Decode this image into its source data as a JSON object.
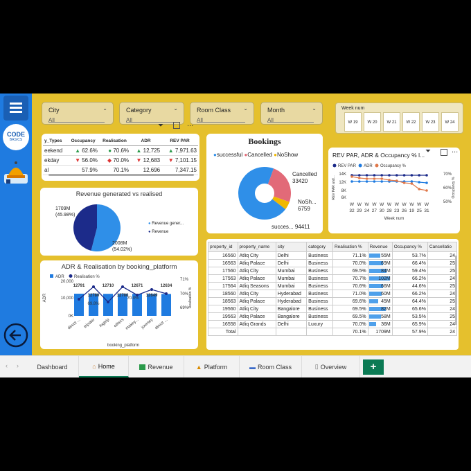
{
  "slicers": [
    {
      "label": "City",
      "value": "All"
    },
    {
      "label": "Category",
      "value": "All"
    },
    {
      "label": "Room Class",
      "value": "All"
    },
    {
      "label": "Month",
      "value": "All"
    }
  ],
  "week_slicer": {
    "label": "Week num",
    "weeks": [
      "W 19",
      "W 20",
      "W 21",
      "W 22",
      "W 23",
      "W 24"
    ]
  },
  "kpi_table": {
    "headers": [
      "y_Types",
      "Occupancy",
      "Realisation",
      "ADR",
      "REV PAR"
    ],
    "rows": [
      {
        "type": "eekend",
        "occupancy": "62.6%",
        "realisation": "70.6%",
        "adr": "12,725",
        "revpar": "7,971.63",
        "occ_icon": "up",
        "real_icon": "circle",
        "adr_icon": "up",
        "rev_icon": "up"
      },
      {
        "type": "ekday",
        "occupancy": "56.0%",
        "realisation": "70.0%",
        "adr": "12,683",
        "revpar": "7,101.15",
        "occ_icon": "down",
        "real_icon": "diamond",
        "adr_icon": "down",
        "rev_icon": "down"
      },
      {
        "type": "al",
        "occupancy": "57.9%",
        "realisation": "70.1%",
        "adr": "12,696",
        "revpar": "7,347.15"
      }
    ]
  },
  "bookings": {
    "title": "Bookings",
    "legend": [
      "successful",
      "Cancelled",
      "NoShow"
    ],
    "labels": {
      "cancelled_name": "Cancelled",
      "cancelled_value": "33420",
      "noshow_name": "NoSh...",
      "noshow_value": "6759",
      "success_name": "succes...",
      "success_value": "94411"
    },
    "colors": [
      "#2f8fe8",
      "#e26a78",
      "#f0b800"
    ]
  },
  "revpar_chart": {
    "title": "REV PAR, ADR & Occupancy % l...",
    "legend": [
      "REV PAR",
      "ADR",
      "Occupancy %"
    ],
    "y_left": [
      "14K",
      "12K",
      "8K",
      "6K"
    ],
    "y_right": [
      "70%",
      "60%",
      "50%"
    ],
    "y_left_label": "REV PAR and...",
    "y_right_label": "Occupancy %",
    "x_labels": [
      "W\n32",
      "W\n29",
      "W\n24",
      "W\n27",
      "W\n30",
      "W\n28",
      "W\n23",
      "W\n26",
      "W\n19",
      "W\n25",
      "W\n31"
    ],
    "xlabel": "Week num"
  },
  "revenue_pie": {
    "title": "Revenue generated vs realised",
    "labels": {
      "left_value": "1709M",
      "left_pct": "(45.98%)",
      "right_value": "2008M",
      "right_pct": "(54.02%)"
    },
    "legend": [
      "Revenue gener...",
      "Revenue"
    ],
    "colors": [
      "#2f8fe8",
      "#1c2b8a"
    ]
  },
  "adr_chart": {
    "title": "ADR & Realisation by booking_platform",
    "legend": [
      "ADR",
      "Realisation %"
    ],
    "y_left": [
      "20,000",
      "10,000",
      "0K"
    ],
    "y_right": [
      "71%",
      "70%",
      "69%"
    ],
    "y_left_label": "ADR",
    "y_right_label": "Realisation %",
    "bar_labels": [
      "12791",
      "12780",
      "12710",
      "12700",
      "12671",
      "12649",
      "12634"
    ],
    "line_labels": [
      "69.8%",
      "70.0%"
    ],
    "categories": [
      "direct ...",
      "tripster",
      "logtrip",
      "others",
      "makey...",
      "journey",
      "direct ..."
    ],
    "xlabel": "booking_platform"
  },
  "prop_table": {
    "headers": [
      "property_id",
      "property_name",
      "city",
      "category",
      "Realisation %",
      "Revenue",
      "Occupancy %",
      "Cancellatio"
    ],
    "rows": [
      [
        "16560",
        "Atliq City",
        "Delhi",
        "Business",
        "71.1%",
        "55M",
        "53.7%",
        "24"
      ],
      [
        "16563",
        "Atliq Palace",
        "Delhi",
        "Business",
        "70.0%",
        "69M",
        "66.4%",
        "25"
      ],
      [
        "17560",
        "Atliq City",
        "Mumbai",
        "Business",
        "69.5%",
        "84M",
        "59.4%",
        "25"
      ],
      [
        "17563",
        "Atliq Palace",
        "Mumbai",
        "Business",
        "70.7%",
        "102M",
        "66.2%",
        "24"
      ],
      [
        "17564",
        "Atliq Seasons",
        "Mumbai",
        "Business",
        "70.6%",
        "66M",
        "44.6%",
        "25"
      ],
      [
        "18560",
        "Atliq City",
        "Hyderabad",
        "Business",
        "71.0%",
        "60M",
        "66.2%",
        "24"
      ],
      [
        "18563",
        "Atliq Palace",
        "Hyderabad",
        "Business",
        "69.6%",
        "45M",
        "64.4%",
        "25"
      ],
      [
        "19560",
        "Atliq City",
        "Bangalore",
        "Business",
        "69.5%",
        "82M",
        "65.6%",
        "24"
      ],
      [
        "19563",
        "Atliq Palace",
        "Bangalore",
        "Business",
        "69.5%",
        "58M",
        "53.5%",
        "25"
      ],
      [
        "16558",
        "Atliq Grands",
        "Delhi",
        "Luxury",
        "70.0%",
        "36M",
        "65.9%",
        "24"
      ]
    ],
    "total": [
      "Total",
      "",
      "",
      "",
      "70.1%",
      "1709M",
      "57.9%",
      "24"
    ]
  },
  "tabs": [
    "Dashboard",
    "Home",
    "Revenue",
    "Platform",
    "Room Class",
    "Overview"
  ],
  "add_tab": "+",
  "logo": {
    "line1": "CODE",
    "line2": "BASICS"
  },
  "toolbar_more": "..."
}
